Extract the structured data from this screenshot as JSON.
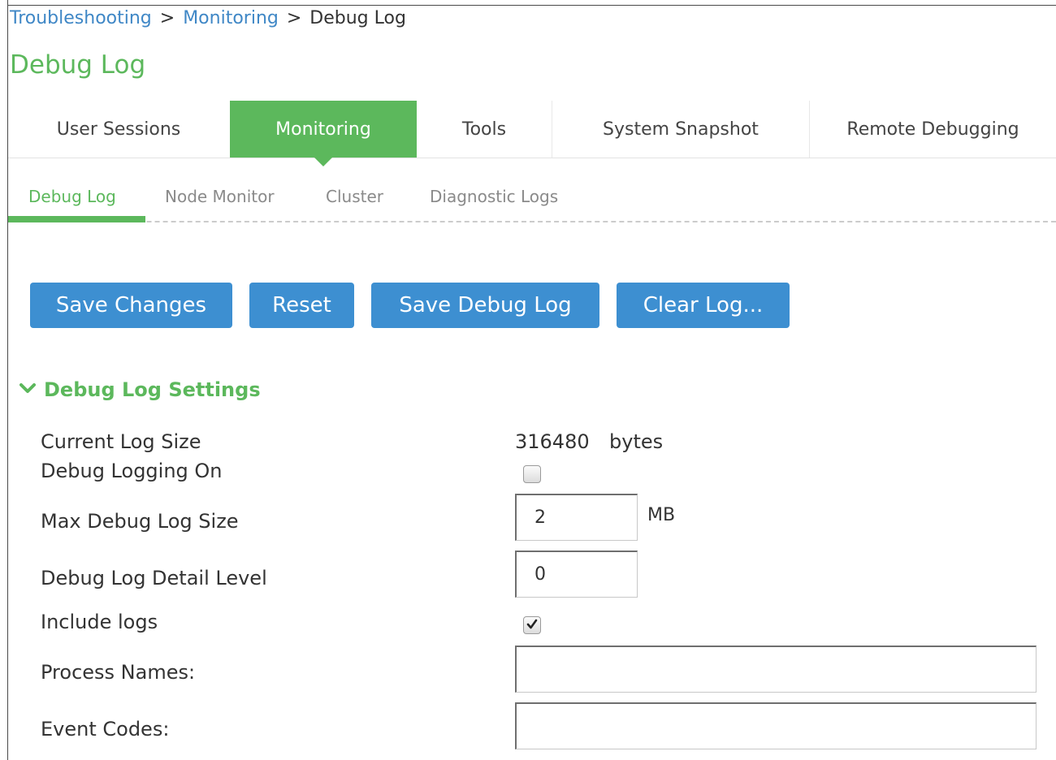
{
  "breadcrumb": {
    "items": [
      "Troubleshooting",
      "Monitoring"
    ],
    "current": "Debug Log",
    "separator": ">"
  },
  "page_title": "Debug Log",
  "tabs": [
    {
      "label": "User Sessions",
      "active": false
    },
    {
      "label": "Monitoring",
      "active": true
    },
    {
      "label": "Tools",
      "active": false
    },
    {
      "label": "System Snapshot",
      "active": false
    },
    {
      "label": "Remote Debugging",
      "active": false
    }
  ],
  "subtabs": [
    {
      "label": "Debug Log",
      "active": true
    },
    {
      "label": "Node Monitor",
      "active": false
    },
    {
      "label": "Cluster",
      "active": false
    },
    {
      "label": "Diagnostic Logs",
      "active": false
    }
  ],
  "buttons": {
    "save_changes": "Save Changes",
    "reset": "Reset",
    "save_debug_log": "Save Debug Log",
    "clear_log": "Clear Log..."
  },
  "section": {
    "title": "Debug Log Settings",
    "icon": "chevron-down-icon"
  },
  "settings": {
    "current_log_size": {
      "label": "Current Log Size",
      "value": "316480",
      "unit": "bytes"
    },
    "debug_logging_on": {
      "label": "Debug Logging On",
      "checked": false
    },
    "max_debug_log_size": {
      "label": "Max Debug Log Size",
      "value": "2",
      "unit": "MB"
    },
    "debug_log_detail_level": {
      "label": "Debug Log Detail Level",
      "value": "0"
    },
    "include_logs": {
      "label": "Include logs",
      "checked": true
    },
    "process_names": {
      "label": "Process Names:",
      "value": ""
    },
    "event_codes": {
      "label": "Event Codes:",
      "value": ""
    }
  },
  "colors": {
    "accent_green": "#5cb85c",
    "button_blue": "#3d8fd1",
    "link_blue": "#3f87c6"
  }
}
